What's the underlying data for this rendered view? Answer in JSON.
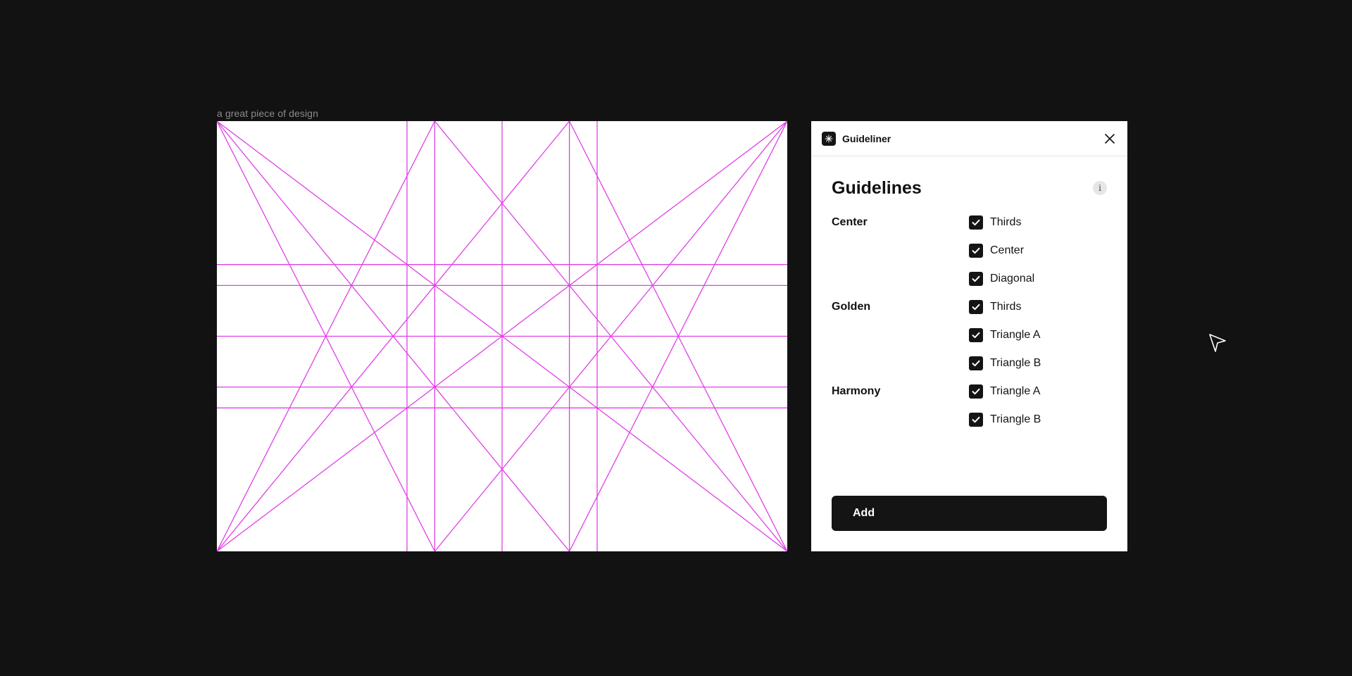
{
  "canvas": {
    "frame_label": "a great piece of design",
    "guide_color": "#e040e6"
  },
  "panel": {
    "plugin_name": "Guideliner",
    "title": "Guidelines",
    "info_glyph": "i",
    "groups": [
      {
        "label": "Center",
        "options": [
          {
            "label": "Thirds",
            "checked": true
          },
          {
            "label": "Center",
            "checked": true
          },
          {
            "label": "Diagonal",
            "checked": true
          }
        ]
      },
      {
        "label": "Golden",
        "options": [
          {
            "label": "Thirds",
            "checked": true
          },
          {
            "label": "Triangle A",
            "checked": true
          },
          {
            "label": "Triangle B",
            "checked": true
          }
        ]
      },
      {
        "label": "Harmony",
        "options": [
          {
            "label": "Triangle A",
            "checked": true
          },
          {
            "label": "Triangle B",
            "checked": true
          }
        ]
      }
    ],
    "add_label": "Add"
  }
}
